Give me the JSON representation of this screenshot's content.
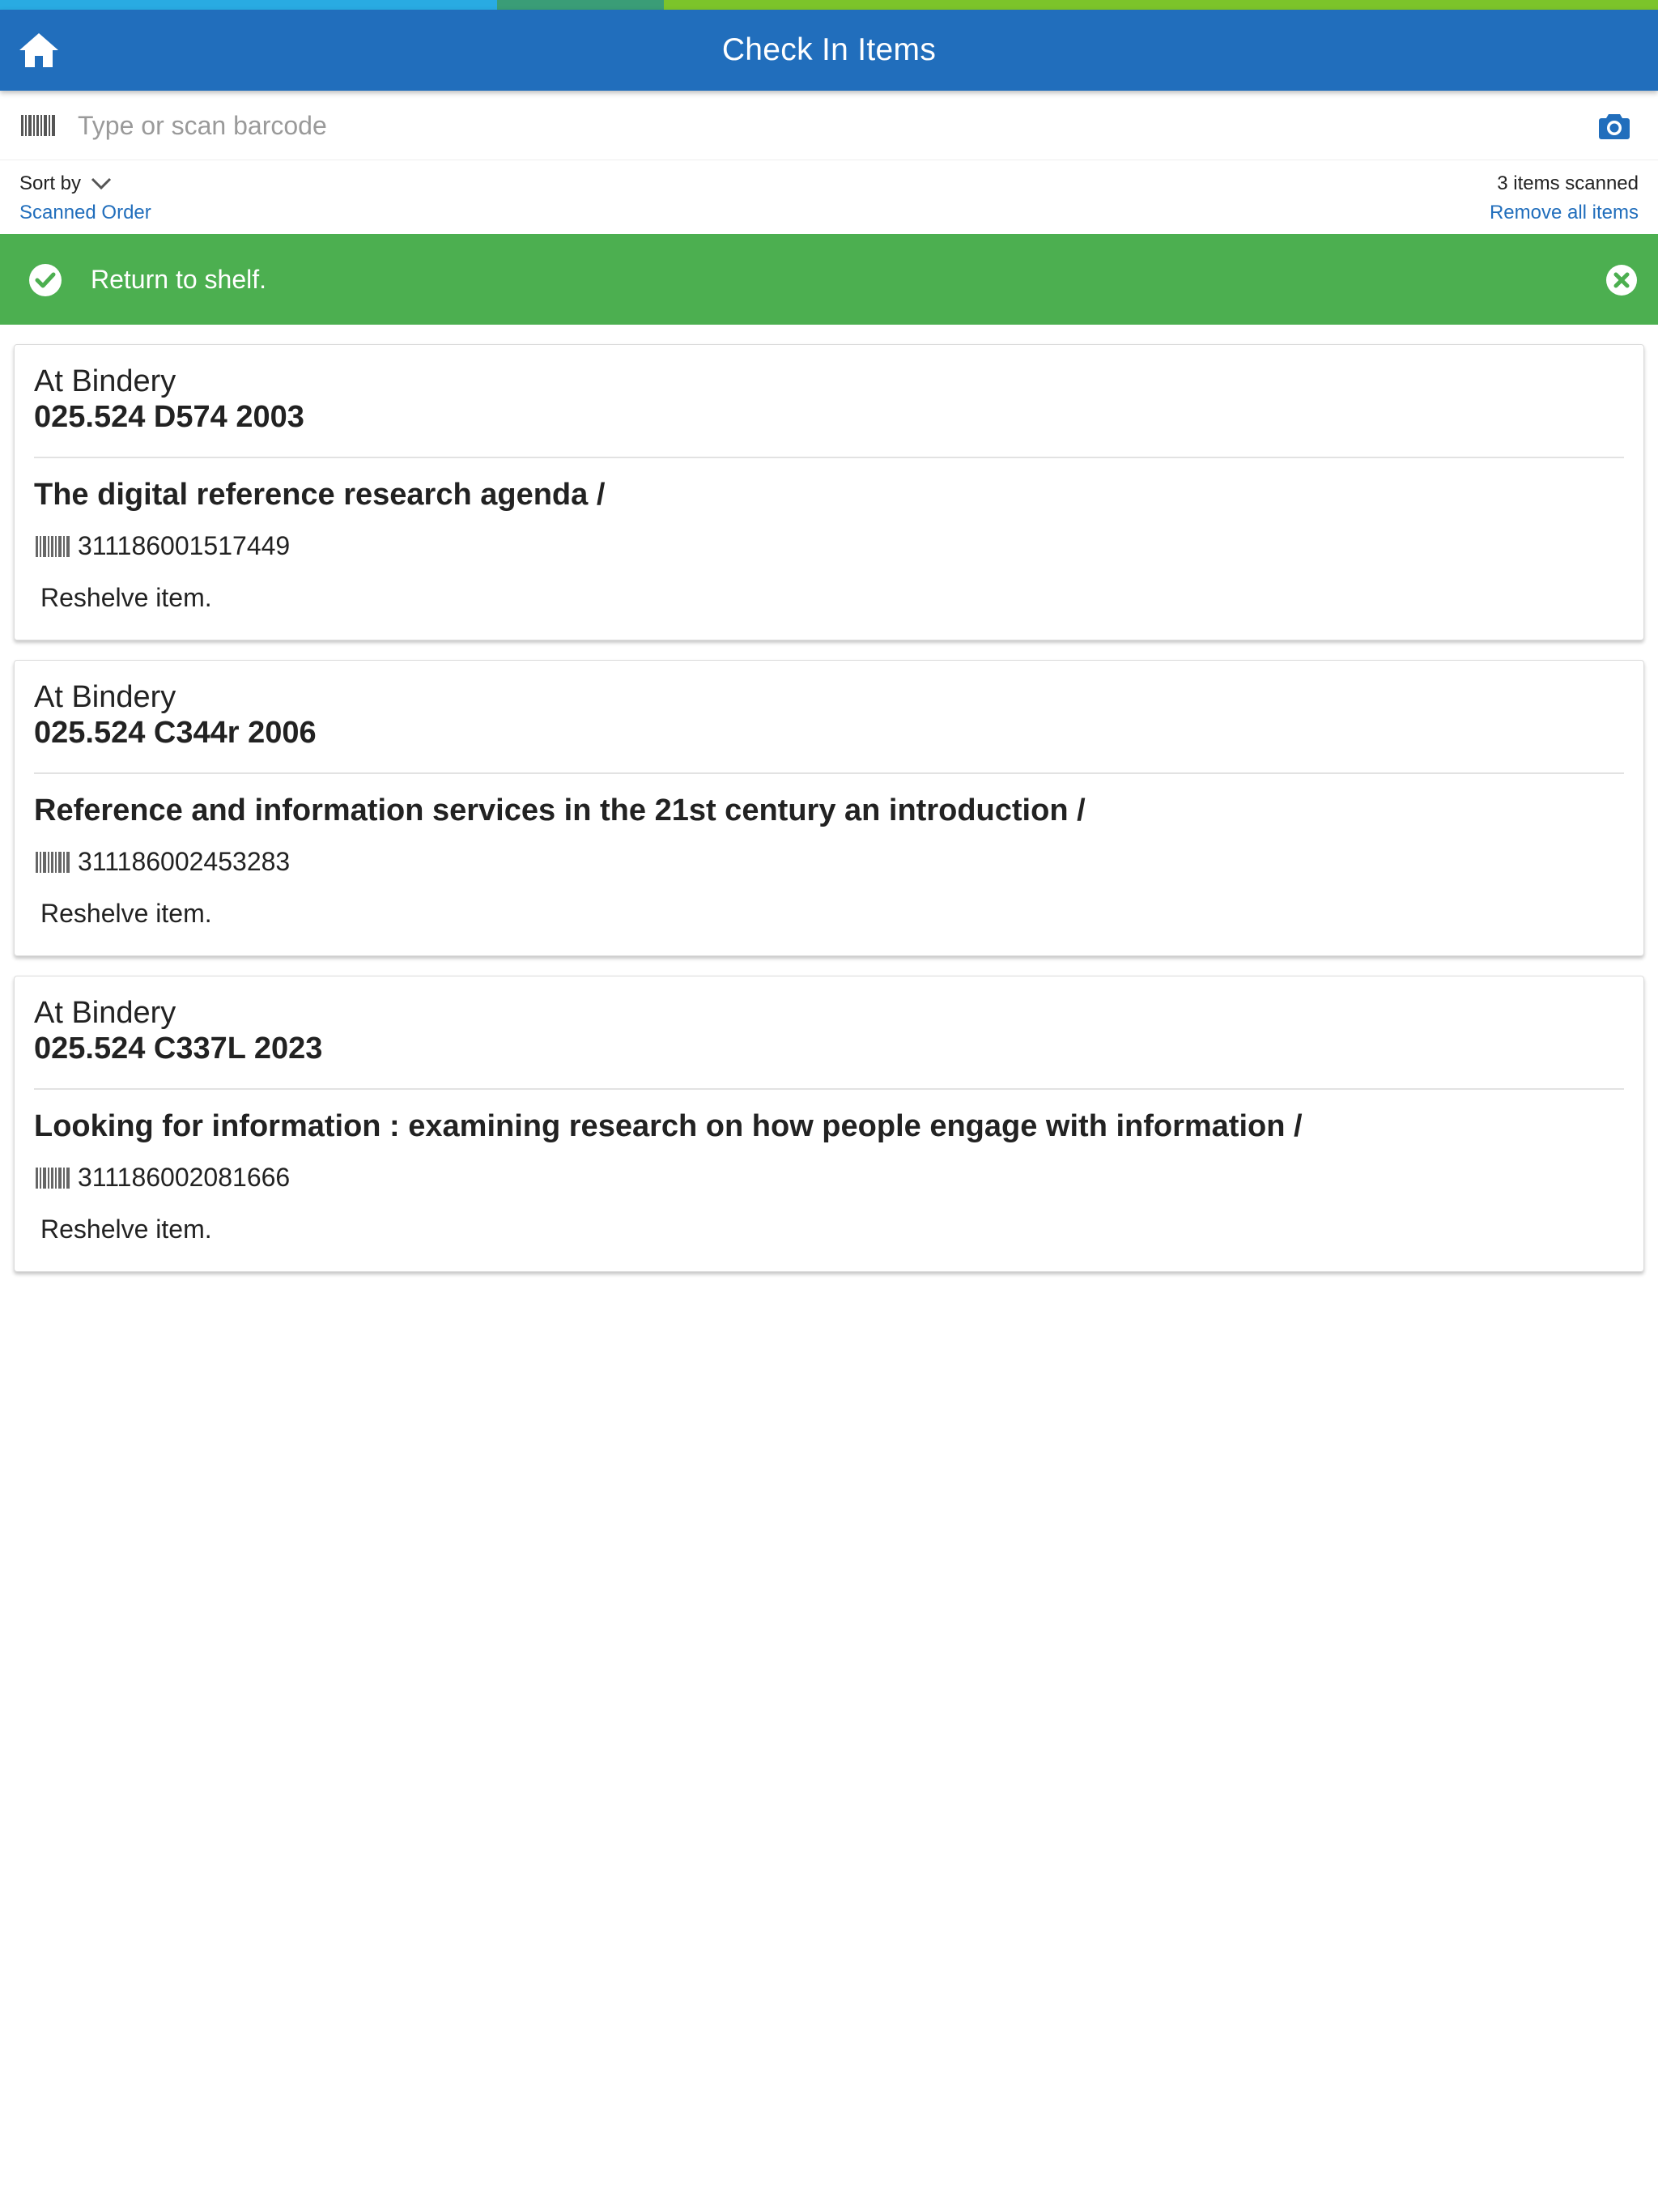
{
  "header": {
    "title": "Check In Items",
    "home_icon": "home-icon",
    "bar_color": "#216ebc"
  },
  "progress_strip": {
    "colors": [
      "#29abe2",
      "#3a9d77",
      "#7cc42a"
    ]
  },
  "search": {
    "placeholder": "Type or scan barcode",
    "value": "",
    "left_icon": "barcode-icon",
    "right_icon": "camera-icon"
  },
  "sort": {
    "label": "Sort by",
    "value": "Scanned Order",
    "icon": "chevron-down-icon"
  },
  "summary": {
    "count_text": "3 items scanned",
    "remove_all_label": "Remove all items"
  },
  "banner": {
    "message": "Return to shelf.",
    "color": "#4caf50",
    "status_icon": "check-circle-icon",
    "dismiss_icon": "close-circle-icon"
  },
  "items": [
    {
      "status": "At Bindery",
      "call_number": "025.524 D574 2003",
      "title": "The digital reference research agenda /",
      "barcode": "311186001517449",
      "note": "Reshelve item."
    },
    {
      "status": "At Bindery",
      "call_number": "025.524 C344r 2006",
      "title": "Reference and information services in the 21st century an introduction /",
      "barcode": "311186002453283",
      "note": "Reshelve item."
    },
    {
      "status": "At Bindery",
      "call_number": "025.524 C337L 2023",
      "title": "Looking for information : examining research on how people engage with information /",
      "barcode": "311186002081666",
      "note": "Reshelve item."
    }
  ]
}
